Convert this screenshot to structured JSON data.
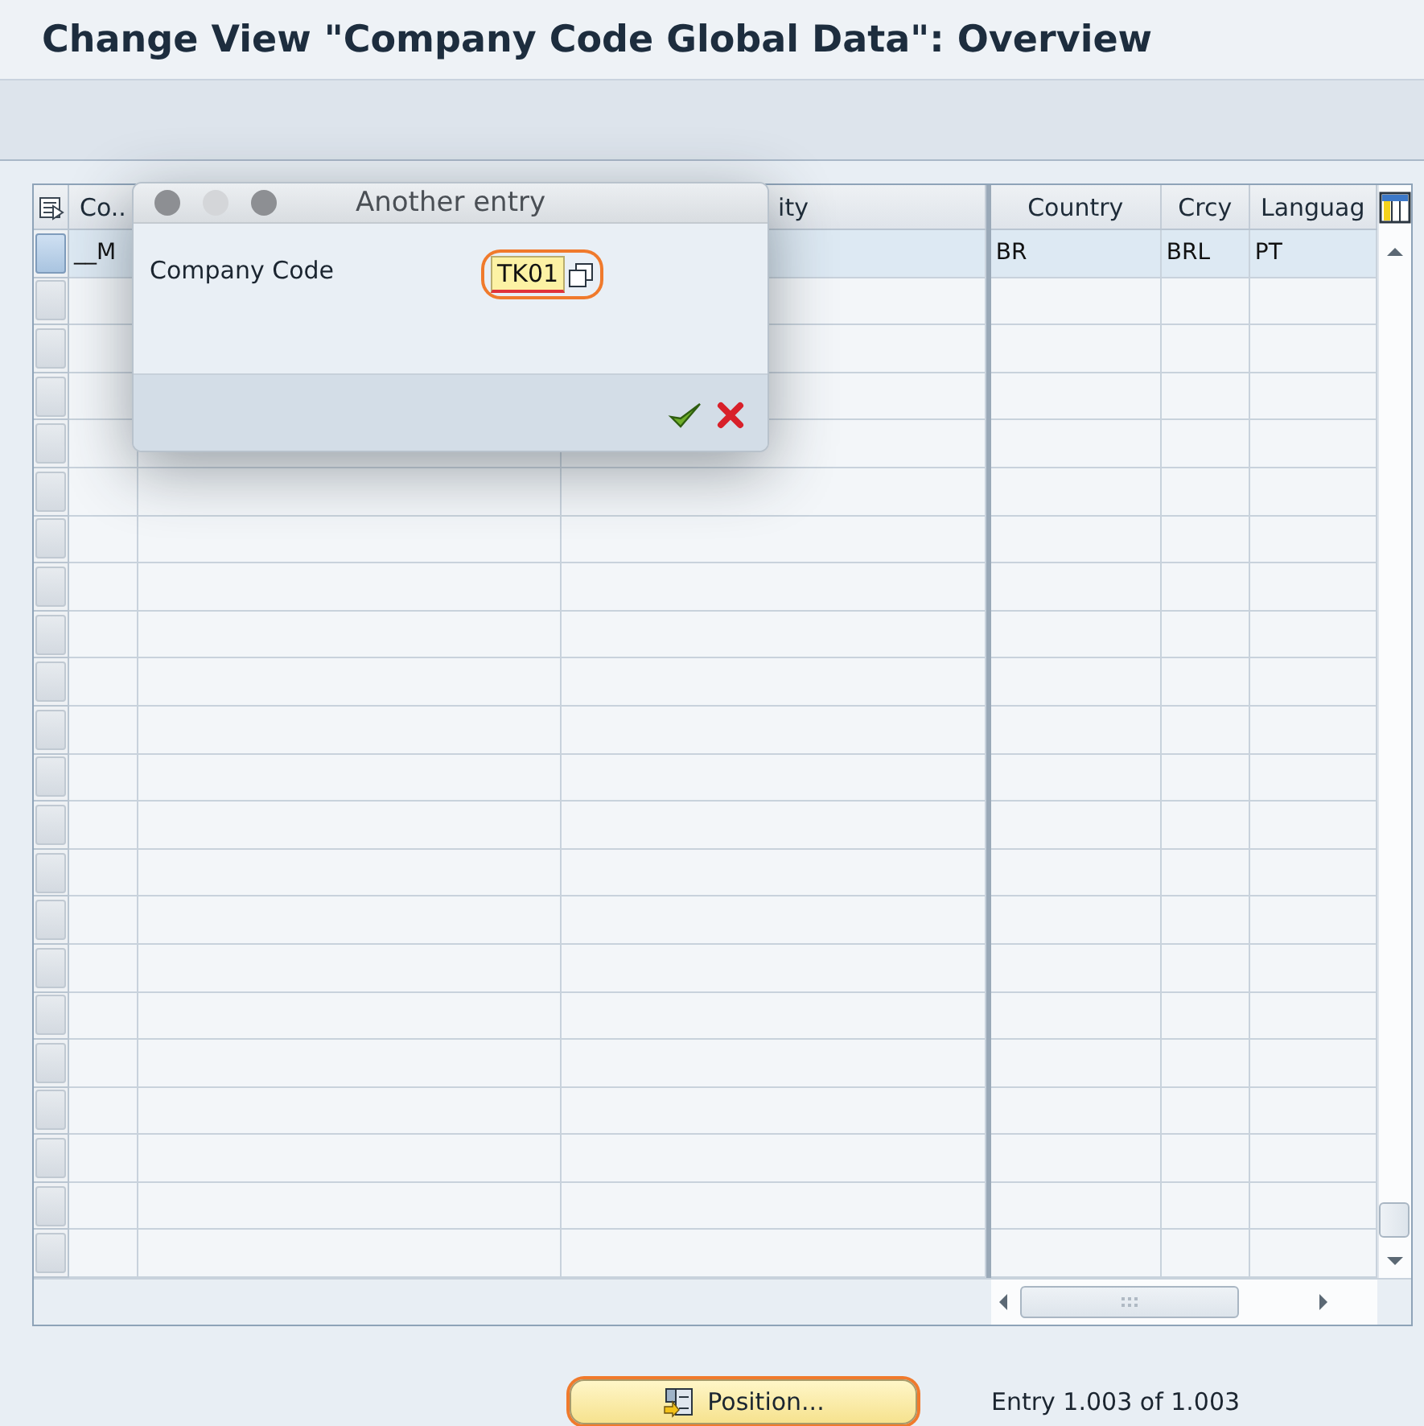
{
  "window": {
    "title": "Change View \"Company Code Global Data\": Overview"
  },
  "table": {
    "left_columns": [
      {
        "label": "Co.."
      },
      {},
      {
        "label": "ity"
      }
    ],
    "right_columns": [
      {
        "label": "Country"
      },
      {
        "label": "Crcy"
      },
      {
        "label": "Languag"
      }
    ],
    "rows": [
      {
        "selected": true,
        "left_cells": [
          "__M"
        ],
        "right_cells": [
          "BR",
          "BRL",
          "PT"
        ]
      },
      {
        "selected": false
      },
      {
        "selected": false
      },
      {
        "selected": false
      },
      {
        "selected": false
      },
      {
        "selected": false
      },
      {
        "selected": false
      },
      {
        "selected": false
      },
      {
        "selected": false
      },
      {
        "selected": false
      },
      {
        "selected": false
      },
      {
        "selected": false
      },
      {
        "selected": false
      },
      {
        "selected": false
      },
      {
        "selected": false
      },
      {
        "selected": false
      },
      {
        "selected": false
      },
      {
        "selected": false
      },
      {
        "selected": false
      },
      {
        "selected": false
      },
      {
        "selected": false
      },
      {
        "selected": false
      }
    ]
  },
  "dialog": {
    "title": "Another entry",
    "field": {
      "label": "Company Code",
      "value": "TK01",
      "highlighted": true
    }
  },
  "footer": {
    "position_button": {
      "label": "Position...",
      "highlighted": true
    },
    "status": "Entry 1.003 of 1.003"
  }
}
